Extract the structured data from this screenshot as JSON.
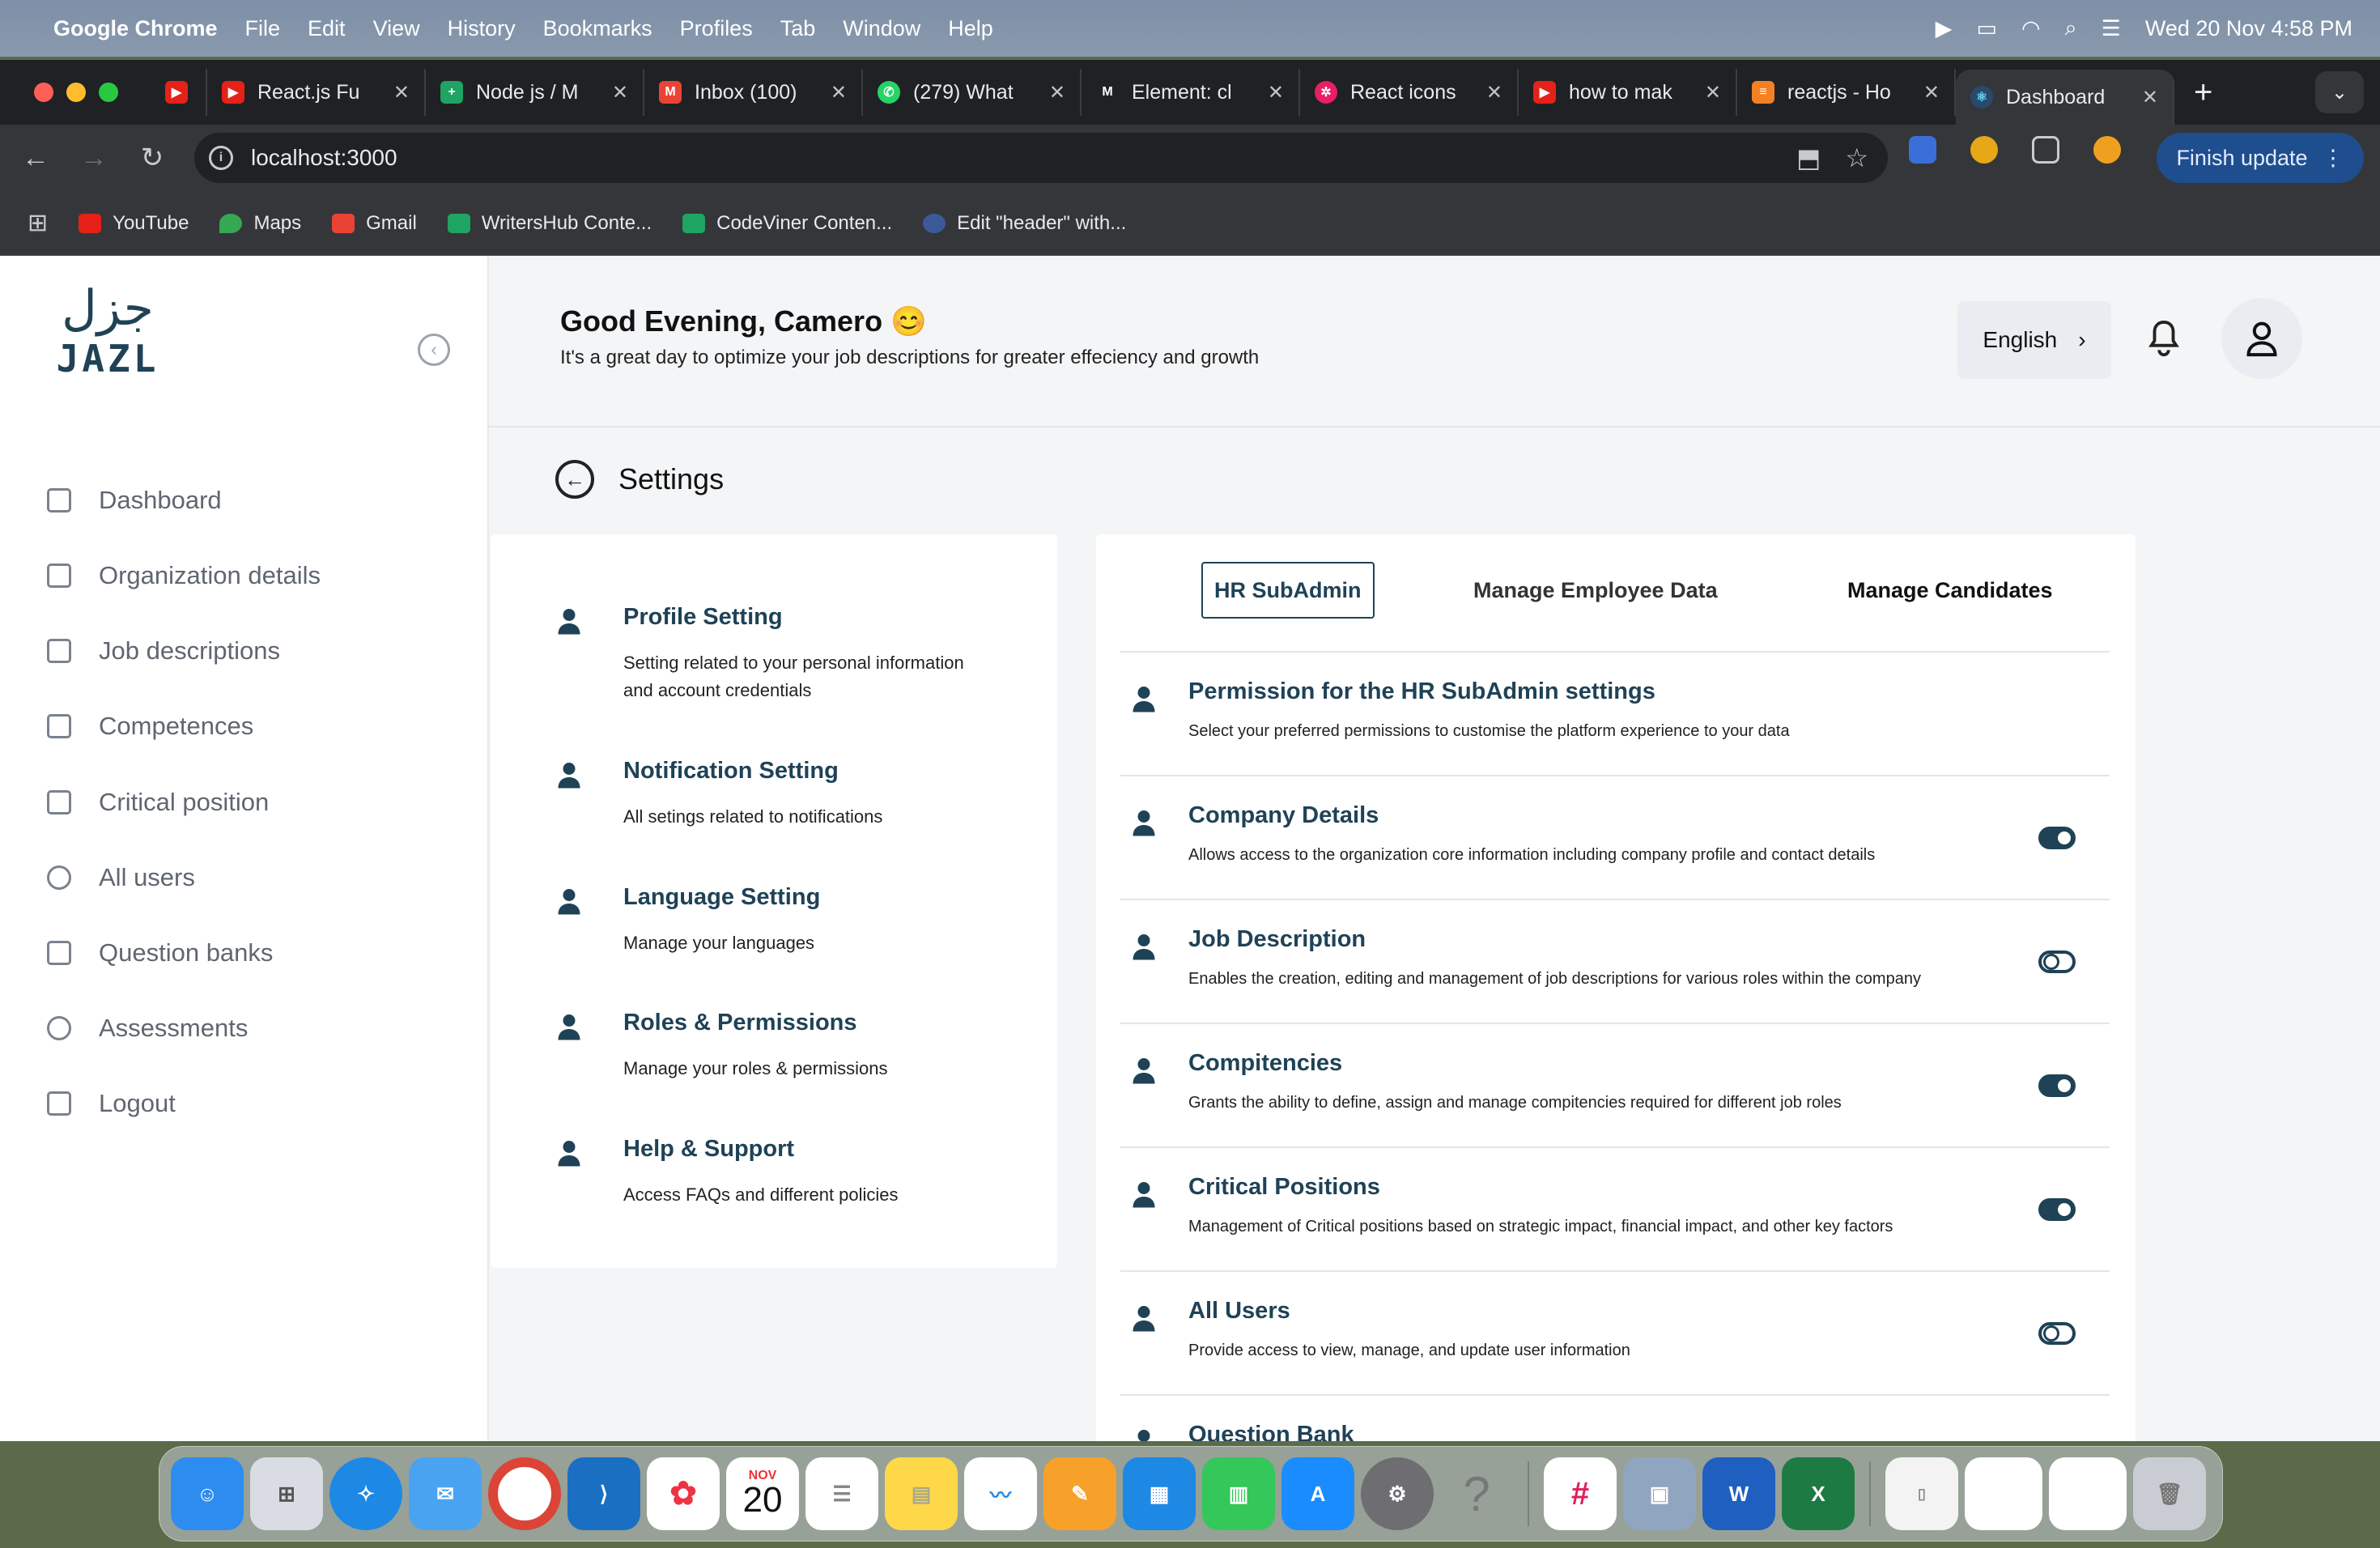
{
  "menubar": {
    "app": "Google Chrome",
    "items": [
      "File",
      "Edit",
      "View",
      "History",
      "Bookmarks",
      "Profiles",
      "Tab",
      "Window",
      "Help"
    ],
    "datetime": "Wed 20 Nov  4:58 PM"
  },
  "tabs": [
    {
      "title": "",
      "color": "#e62117",
      "icon": "youtube-icon"
    },
    {
      "title": "React.js Fu",
      "color": "#e62117",
      "icon": "youtube-icon"
    },
    {
      "title": "Node js / M",
      "color": "#1fa463",
      "icon": "sheets-icon"
    },
    {
      "title": "Inbox (100)",
      "color": "#ea4335",
      "icon": "gmail-icon"
    },
    {
      "title": "(279) What",
      "color": "#25d366",
      "icon": "whatsapp-icon"
    },
    {
      "title": "Element: cl",
      "color": "#202124",
      "icon": "mdn-icon"
    },
    {
      "title": "React icons",
      "color": "#e91e63",
      "icon": "react-icons-icon"
    },
    {
      "title": "how to mak",
      "color": "#e62117",
      "icon": "youtube-icon"
    },
    {
      "title": "reactjs - Ho",
      "color": "#f48024",
      "icon": "stackoverflow-icon"
    },
    {
      "title": "Dashboard",
      "color": "#61dafb",
      "icon": "react-icon"
    }
  ],
  "address": {
    "url": "localhost:3000"
  },
  "finish_update": "Finish update",
  "bookmarks": [
    {
      "label": "YouTube",
      "color": "#e62117"
    },
    {
      "label": "Maps",
      "color": "#34a853"
    },
    {
      "label": "Gmail",
      "color": "#ea4335"
    },
    {
      "label": "WritersHub Conte...",
      "color": "#1fa463"
    },
    {
      "label": "CodeViner Conten...",
      "color": "#1fa463"
    },
    {
      "label": "Edit \"header\" with...",
      "color": "#3b5998"
    }
  ],
  "sidebar": {
    "logo_arabic": "جزل",
    "logo_text": "JAZL",
    "items": [
      {
        "label": "Dashboard",
        "icon": "grid-icon"
      },
      {
        "label": "Organization details",
        "icon": "building-icon"
      },
      {
        "label": "Job descriptions",
        "icon": "document-icon"
      },
      {
        "label": "Competences",
        "icon": "file-icon"
      },
      {
        "label": "Critical position",
        "icon": "hierarchy-icon"
      },
      {
        "label": "All users",
        "icon": "users-icon"
      },
      {
        "label": "Question banks",
        "icon": "bookmark-icon"
      },
      {
        "label": "Assessments",
        "icon": "plus-circle-icon"
      },
      {
        "label": "Logout",
        "icon": "logout-icon"
      }
    ]
  },
  "header": {
    "greeting": "Good Evening, Camero 😊",
    "subtitle": "It's a great day to optimize your job descriptions for greater effeciency and growth",
    "language": "English"
  },
  "settings": {
    "title": "Settings",
    "items": [
      {
        "title": "Profile Setting",
        "desc": "Setting related to your personal information and account credentials"
      },
      {
        "title": "Notification Setting",
        "desc": "All setings related to notifications"
      },
      {
        "title": "Language Setting",
        "desc": "Manage your languages"
      },
      {
        "title": "Roles & Permissions",
        "desc": "Manage your roles & permissions"
      },
      {
        "title": "Help & Support",
        "desc": "Access FAQs and different policies"
      }
    ]
  },
  "permissions": {
    "tabs": [
      "HR SubAdmin",
      "Manage Employee Data",
      "Manage Candidates"
    ],
    "rows": [
      {
        "title": "Permission for the HR SubAdmin settings",
        "desc": "Select your preferred permissions to customise the platform experience to your data"
      },
      {
        "title": "Company Details",
        "desc": "Allows access to the organization core information including company profile and contact details",
        "on": true
      },
      {
        "title": "Job Description",
        "desc": "Enables the creation, editing and management of job descriptions for various roles within the company",
        "on": false
      },
      {
        "title": "Compitencies",
        "desc": "Grants the ability to define, assign and manage compitencies required for different job roles",
        "on": true
      },
      {
        "title": "Critical Positions",
        "desc": "Management of Critical positions based on strategic impact, financial impact, and other key factors",
        "on": true
      },
      {
        "title": "All Users",
        "desc": "Provide access to view, manage, and update user information",
        "on": false
      },
      {
        "title": "Question Bank",
        "desc": ""
      }
    ]
  },
  "dock": {
    "calendar_month": "NOV",
    "calendar_day": "20"
  }
}
